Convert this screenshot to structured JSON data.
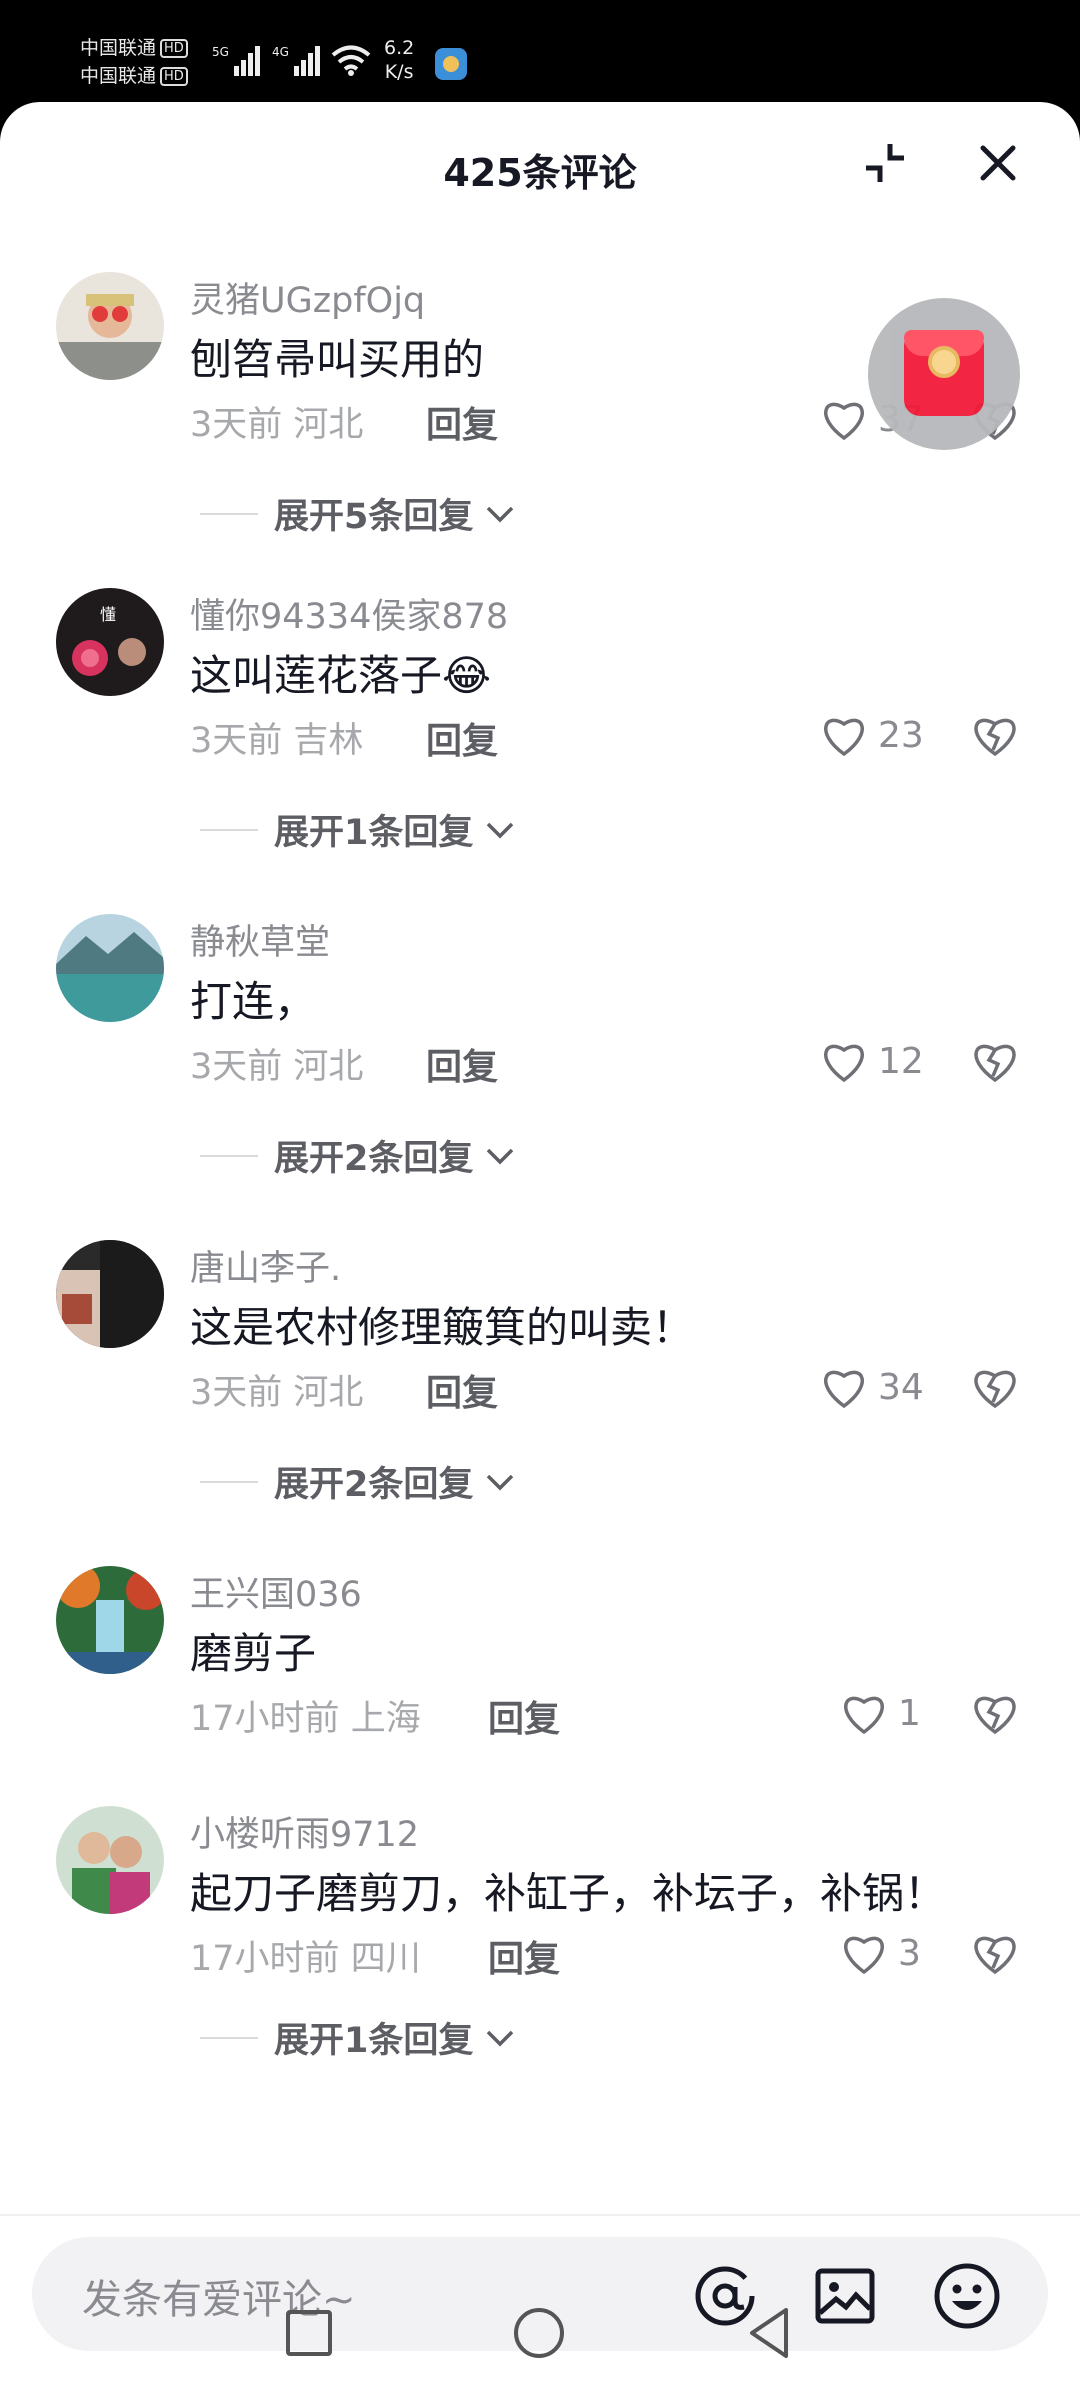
{
  "status_bar": {
    "carrier1": "中国联通",
    "carrier2": "中国联通",
    "hd_badge": "HD",
    "net_speed_value": "6.2",
    "net_speed_unit": "K/s"
  },
  "sheet": {
    "title": "425条评论"
  },
  "comments": [
    {
      "username": "灵猪UGzpfOjq",
      "text": "刨笤帚叫买用的",
      "time": "3天前",
      "location": "河北",
      "reply_label": "回复",
      "likes": "37",
      "expand_label": "展开5条回复"
    },
    {
      "username": "懂你94334侯家878",
      "text": "这叫莲花落子😂",
      "time": "3天前",
      "location": "吉林",
      "reply_label": "回复",
      "likes": "23",
      "expand_label": "展开1条回复"
    },
    {
      "username": "静秋草堂",
      "text": "打连，",
      "time": "3天前",
      "location": "河北",
      "reply_label": "回复",
      "likes": "12",
      "expand_label": "展开2条回复"
    },
    {
      "username": "唐山李子.",
      "text": "这是农村修理簸箕的叫卖！",
      "time": "3天前",
      "location": "河北",
      "reply_label": "回复",
      "likes": "34",
      "expand_label": "展开2条回复"
    },
    {
      "username": "王兴国036",
      "text": "磨剪子",
      "time": "17小时前",
      "location": "上海",
      "reply_label": "回复",
      "likes": "1",
      "expand_label": ""
    },
    {
      "username": "小楼听雨9712",
      "text": "起刀子磨剪刀，补缸子，补坛子，补锅！",
      "time": "17小时前",
      "location": "四川",
      "reply_label": "回复",
      "likes": "3",
      "expand_label": "展开1条回复"
    }
  ],
  "input": {
    "placeholder": "发条有爱评论~"
  },
  "icons": {
    "collapse": "collapse-icon",
    "close": "close-icon",
    "heart": "heart-outline-icon",
    "dislike": "broken-heart-icon",
    "chevron": "chevron-down-icon",
    "at": "at-icon",
    "image": "image-icon",
    "emoji": "emoji-icon",
    "red_packet": "red-packet-icon"
  }
}
